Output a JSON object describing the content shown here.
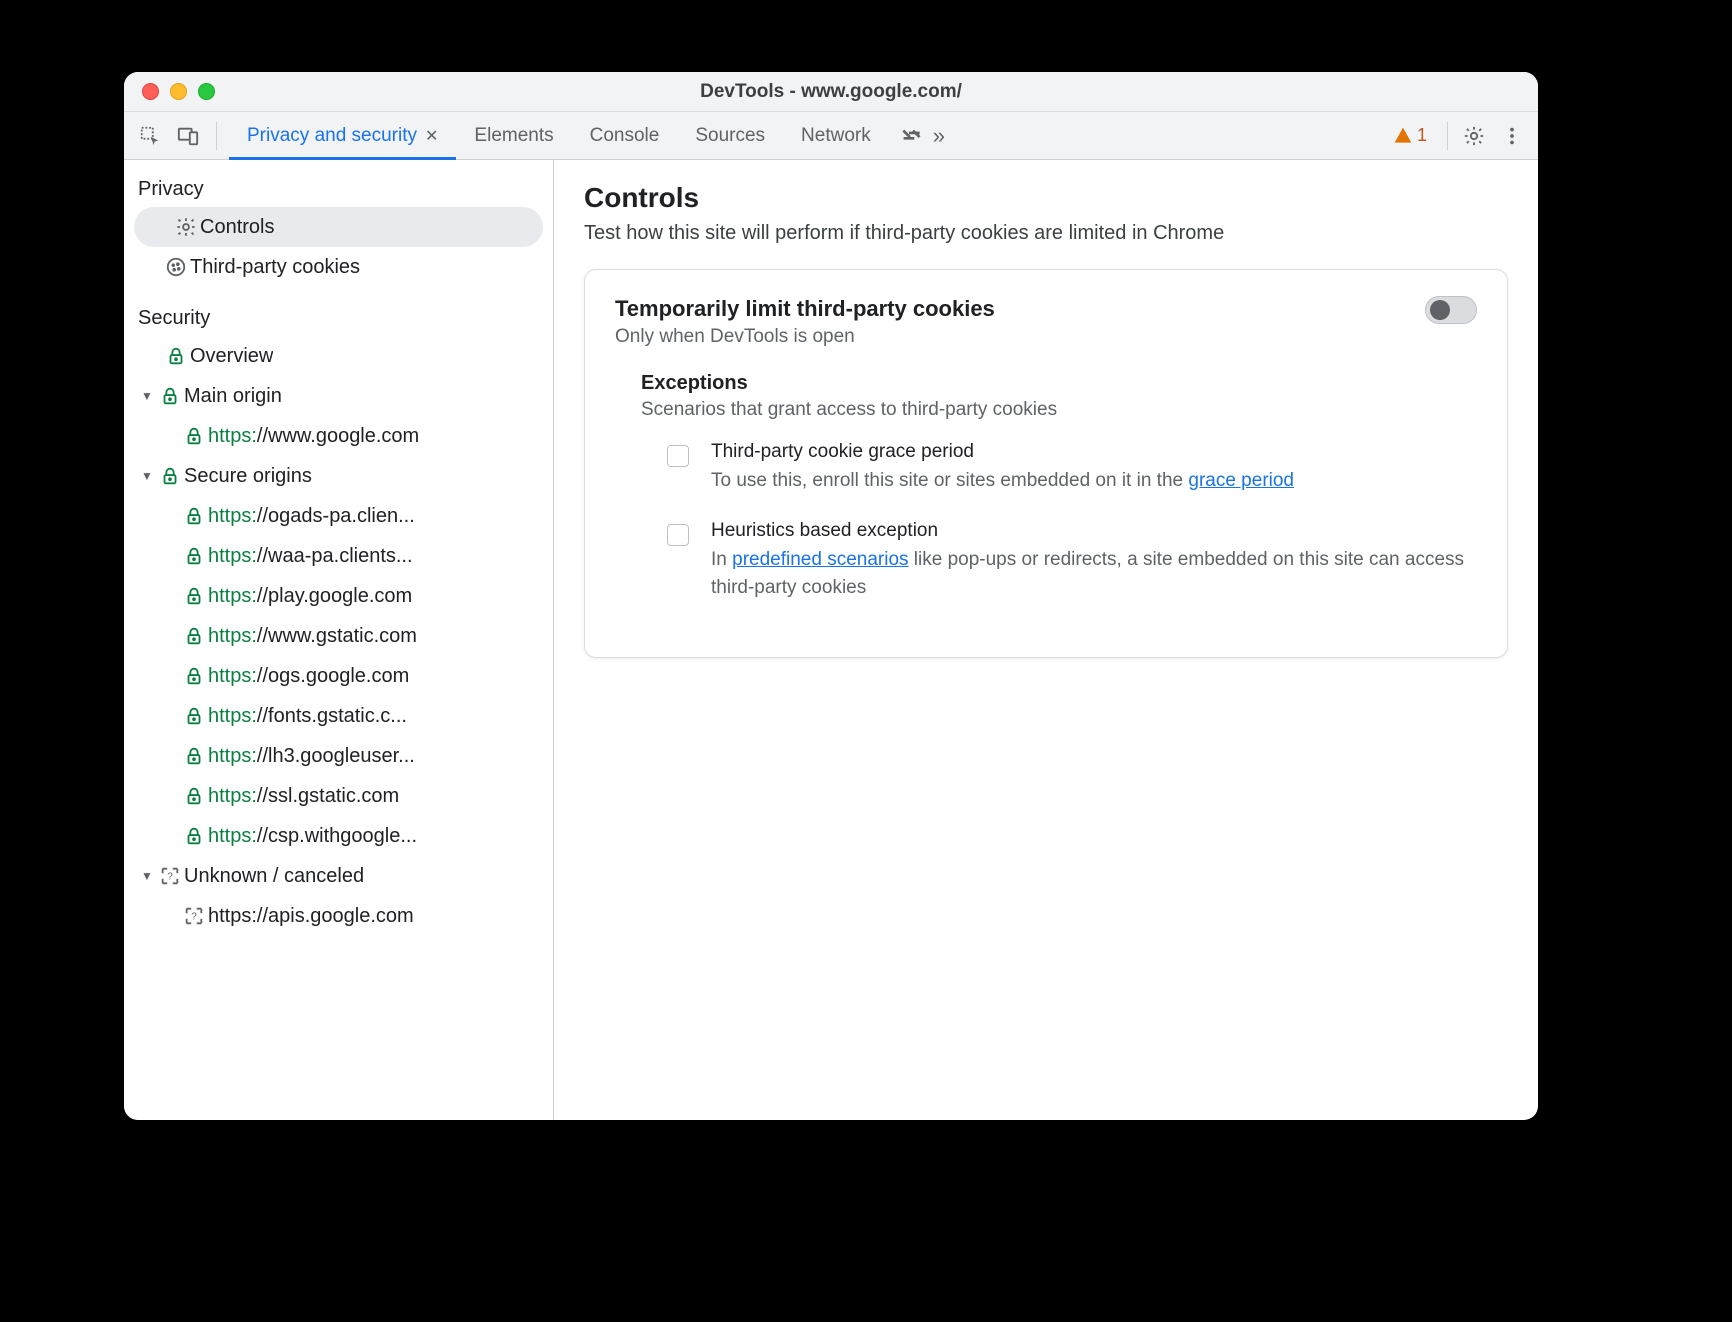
{
  "window": {
    "title": "DevTools - www.google.com/"
  },
  "toolbar": {
    "tabs": [
      {
        "label": "Privacy and security",
        "active": true,
        "closable": true
      },
      {
        "label": "Elements"
      },
      {
        "label": "Console"
      },
      {
        "label": "Sources"
      },
      {
        "label": "Network"
      }
    ],
    "warnings_count": "1"
  },
  "sidebar": {
    "sections": {
      "privacy": {
        "title": "Privacy",
        "items": [
          {
            "id": "controls",
            "label": "Controls",
            "icon": "gear",
            "selected": true
          },
          {
            "id": "tpc",
            "label": "Third-party cookies",
            "icon": "cookie"
          }
        ]
      },
      "security": {
        "title": "Security",
        "overview_label": "Overview",
        "main_origin": {
          "label": "Main origin",
          "url_scheme": "https:",
          "url_rest": "//www.google.com"
        },
        "secure_origins": {
          "label": "Secure origins",
          "items": [
            {
              "scheme": "https:",
              "rest": "//ogads-pa.clien..."
            },
            {
              "scheme": "https:",
              "rest": "//waa-pa.clients..."
            },
            {
              "scheme": "https:",
              "rest": "//play.google.com"
            },
            {
              "scheme": "https:",
              "rest": "//www.gstatic.com"
            },
            {
              "scheme": "https:",
              "rest": "//ogs.google.com"
            },
            {
              "scheme": "https:",
              "rest": "//fonts.gstatic.c..."
            },
            {
              "scheme": "https:",
              "rest": "//lh3.googleuser..."
            },
            {
              "scheme": "https:",
              "rest": "//ssl.gstatic.com"
            },
            {
              "scheme": "https:",
              "rest": "//csp.withgoogle..."
            }
          ]
        },
        "unknown": {
          "label": "Unknown / canceled",
          "items": [
            {
              "text": "https://apis.google.com"
            }
          ]
        }
      }
    }
  },
  "content": {
    "heading": "Controls",
    "subheading": "Test how this site will perform if third-party cookies are limited in Chrome",
    "card": {
      "title": "Temporarily limit third-party cookies",
      "subtitle": "Only when DevTools is open",
      "toggle_on": false,
      "exceptions": {
        "title": "Exceptions",
        "subtitle": "Scenarios that grant access to third-party cookies",
        "items": [
          {
            "title": "Third-party cookie grace period",
            "desc_pre": "To use this, enroll this site or sites embedded on it in the ",
            "link": "grace period",
            "desc_post": ""
          },
          {
            "title": "Heuristics based exception",
            "desc_pre": "In ",
            "link": "predefined scenarios",
            "desc_post": " like pop-ups or redirects, a site embedded on this site can access third-party cookies"
          }
        ]
      }
    }
  }
}
